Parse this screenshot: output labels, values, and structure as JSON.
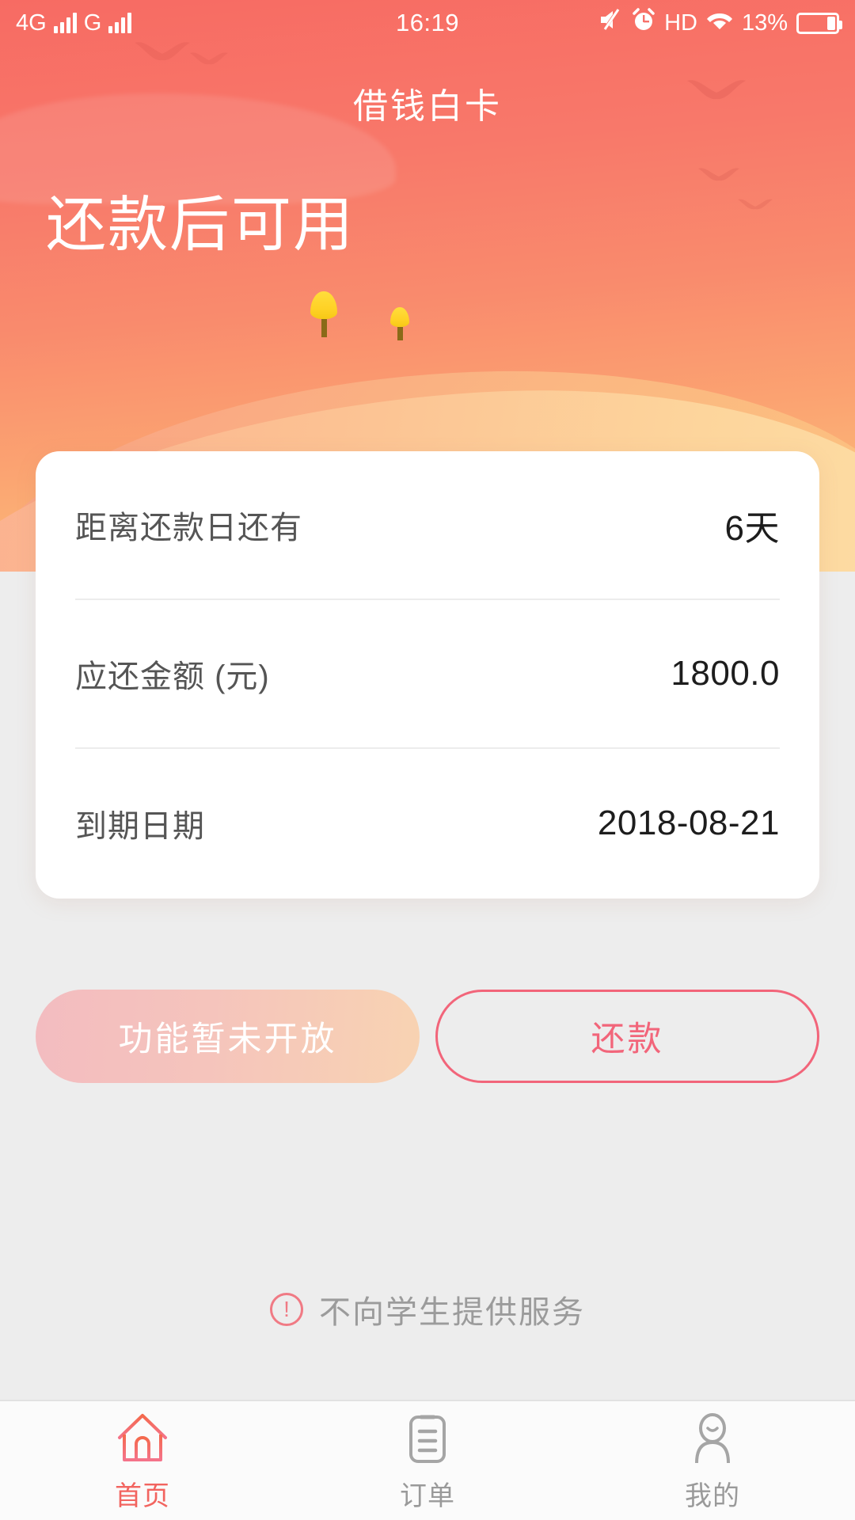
{
  "status_bar": {
    "network_primary": "4G",
    "network_secondary": "G",
    "time": "16:19",
    "hd_label": "HD",
    "battery_percent": "13%",
    "icons": [
      "signal-bars-icon",
      "signal-bars-icon",
      "mute-icon",
      "alarm-clock-icon",
      "hd-icon",
      "wifi-icon",
      "battery-icon"
    ]
  },
  "header": {
    "title": "借钱白卡",
    "headline": "还款后可用",
    "accent_color": "#f76b63",
    "gradient_end_color": "#fbc07c"
  },
  "card": {
    "rows": [
      {
        "label": "距离还款日还有",
        "value": "6天"
      },
      {
        "label": "应还金额 (元)",
        "value": "1800.0"
      },
      {
        "label": "到期日期",
        "value": "2018-08-21"
      }
    ]
  },
  "actions": {
    "disabled_button": "功能暂未开放",
    "repay_button": "还款",
    "repay_color": "#f2657a"
  },
  "notice": {
    "icon": "exclamation-circle-icon",
    "text": "不向学生提供服务",
    "icon_glyph": "!",
    "icon_color": "#f07a84"
  },
  "tabbar": {
    "items": [
      {
        "label": "首页",
        "icon": "home-icon",
        "active": true
      },
      {
        "label": "订单",
        "icon": "orders-document-icon",
        "active": false
      },
      {
        "label": "我的",
        "icon": "profile-person-icon",
        "active": false
      }
    ],
    "active_color": "#f2645f",
    "inactive_color": "#9a9a9a"
  }
}
